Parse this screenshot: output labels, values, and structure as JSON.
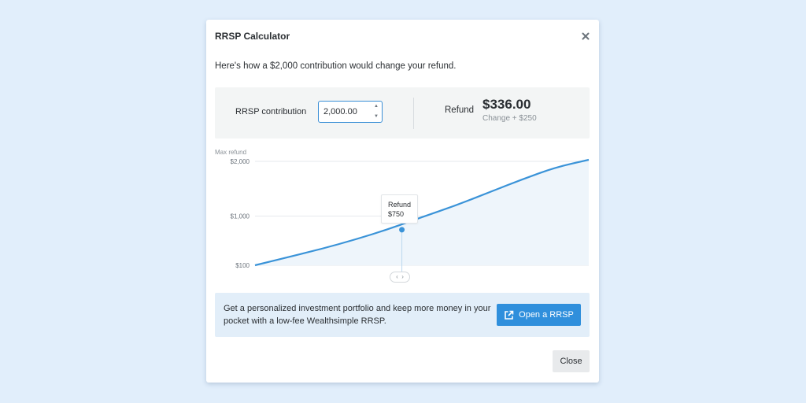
{
  "modal": {
    "title": "RRSP Calculator",
    "intro": "Here's how a $2,000 contribution would change your refund."
  },
  "calculator": {
    "contribution_label": "RRSP contribution",
    "contribution_value": "2,000.00",
    "refund_label": "Refund",
    "refund_amount": "$336.00",
    "refund_change": "Change + $250"
  },
  "chart_data": {
    "type": "area",
    "title": "",
    "ylabel": "Max refund",
    "y_ticks": [
      "$2,000",
      "$1,000",
      "$100"
    ],
    "y_tick_values": [
      2000,
      1000,
      100
    ],
    "ylim": [
      100,
      2000
    ],
    "x": [
      0,
      0.1,
      0.2,
      0.3,
      0.4,
      0.5,
      0.6,
      0.7,
      0.8,
      0.9,
      1.0
    ],
    "values": [
      100,
      250,
      400,
      570,
      760,
      980,
      1190,
      1430,
      1670,
      1890,
      2100
    ],
    "grid": true,
    "line_color": "#3a93d8",
    "fill_color": "#eef5fb",
    "marker": {
      "x": 0.44,
      "value": 750
    }
  },
  "tooltip": {
    "label": "Refund",
    "value": "$750"
  },
  "slider": {
    "left_glyph": "‹",
    "right_glyph": "›"
  },
  "promo": {
    "text": "Get a personalized investment portfolio and keep more money in your pocket with a low-fee Wealthsimple RRSP.",
    "button_label": "Open a RRSP"
  },
  "footer": {
    "close_label": "Close"
  },
  "colors": {
    "accent": "#2f8fdc",
    "background": "#e1eefb"
  },
  "icons": {
    "close": "close-icon",
    "external": "external-link-icon"
  }
}
